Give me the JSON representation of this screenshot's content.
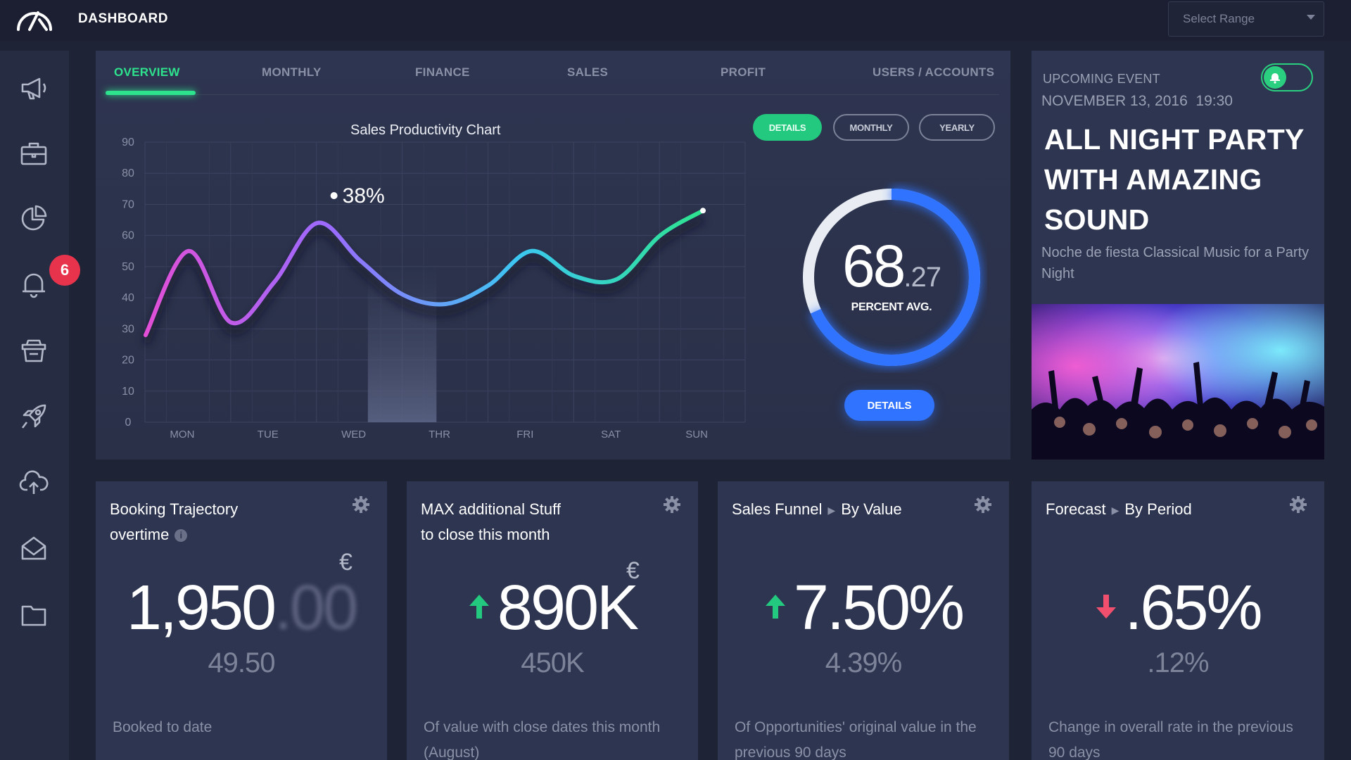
{
  "app": {
    "title": "DASHBOARD"
  },
  "range_select": {
    "placeholder": "Select Range"
  },
  "sidebar": {
    "icons": [
      "megaphone-icon",
      "briefcase-icon",
      "pie-chart-icon",
      "bell-icon",
      "inbox-tray-icon",
      "rocket-icon",
      "cloud-upload-icon",
      "mail-icon",
      "folder-icon"
    ],
    "notification_count": "6"
  },
  "tabs": [
    {
      "label": "OVERVIEW",
      "active": true
    },
    {
      "label": "MONTHLY"
    },
    {
      "label": "FINANCE"
    },
    {
      "label": "SALES"
    },
    {
      "label": "PROFIT"
    },
    {
      "label": "USERS / ACCOUNTS"
    }
  ],
  "chart_controls": {
    "details": "DETAILS",
    "monthly": "MONTHLY",
    "yearly": "YEARLY"
  },
  "chart_data": {
    "type": "line",
    "title": "Sales Productivity Chart",
    "categories": [
      "MON",
      "TUE",
      "WED",
      "THR",
      "FRI",
      "SAT",
      "SUN"
    ],
    "y_ticks": [
      0,
      10,
      20,
      30,
      40,
      50,
      60,
      70,
      80,
      90
    ],
    "ylim": [
      0,
      90
    ],
    "x": [
      0,
      0.5,
      1,
      1.5,
      2,
      2.5,
      3,
      3.5,
      4,
      4.5,
      5,
      5.5,
      6,
      6.5
    ],
    "values": [
      28,
      55,
      32,
      45,
      64,
      52,
      41,
      38,
      44,
      55,
      47,
      46,
      60,
      68
    ],
    "highlight": {
      "category": "WED",
      "label": "38%"
    },
    "grid": true,
    "gradient_colors": [
      "#e24fd6",
      "#9a6bff",
      "#3cc7f2",
      "#2ee38e"
    ]
  },
  "donut": {
    "value": "68",
    "decimal": "27",
    "label": "PERCENT AVG.",
    "percent": 68.27,
    "button": "DETAILS",
    "colors": {
      "fill": "#2f73ff",
      "track": "#e9edf3"
    }
  },
  "event": {
    "label": "UPCOMING EVENT",
    "date": "NOVEMBER 13, 2016  19:30",
    "title": "ALL NIGHT PARTY WITH AMAZING SOUND",
    "description": "Noche de fiesta Classical Music for a Party Night",
    "toggle_on": true
  },
  "cards": [
    {
      "title_line1": "Booking Trajectory",
      "title_line2": "overtime",
      "currency": "€",
      "value": "1,950",
      "value_faded": ".00",
      "sub_value": "49.50",
      "description": "Booked to date"
    },
    {
      "title_line1": "MAX additional Stuff",
      "title_line2": "to close this month",
      "currency": "€",
      "value": "890K",
      "trend": "up",
      "sub_value": "450K",
      "description": "Of value with close dates this month (August)"
    },
    {
      "title_part1": "Sales Funnel",
      "title_part2": "By Value",
      "value": "7.50%",
      "trend": "up",
      "sub_value": "4.39%",
      "description": "Of Opportunities' original value in the previous 90 days"
    },
    {
      "title_part1": "Forecast",
      "title_part2": "By Period",
      "value": ".65%",
      "trend": "down",
      "sub_value": ".12%",
      "description": "Change in overall rate in the previous 90 days"
    }
  ],
  "colors": {
    "accent_green": "#2ee38e",
    "accent_blue": "#2f73ff",
    "alert_red": "#e8334d",
    "down_red": "#f0506e"
  }
}
